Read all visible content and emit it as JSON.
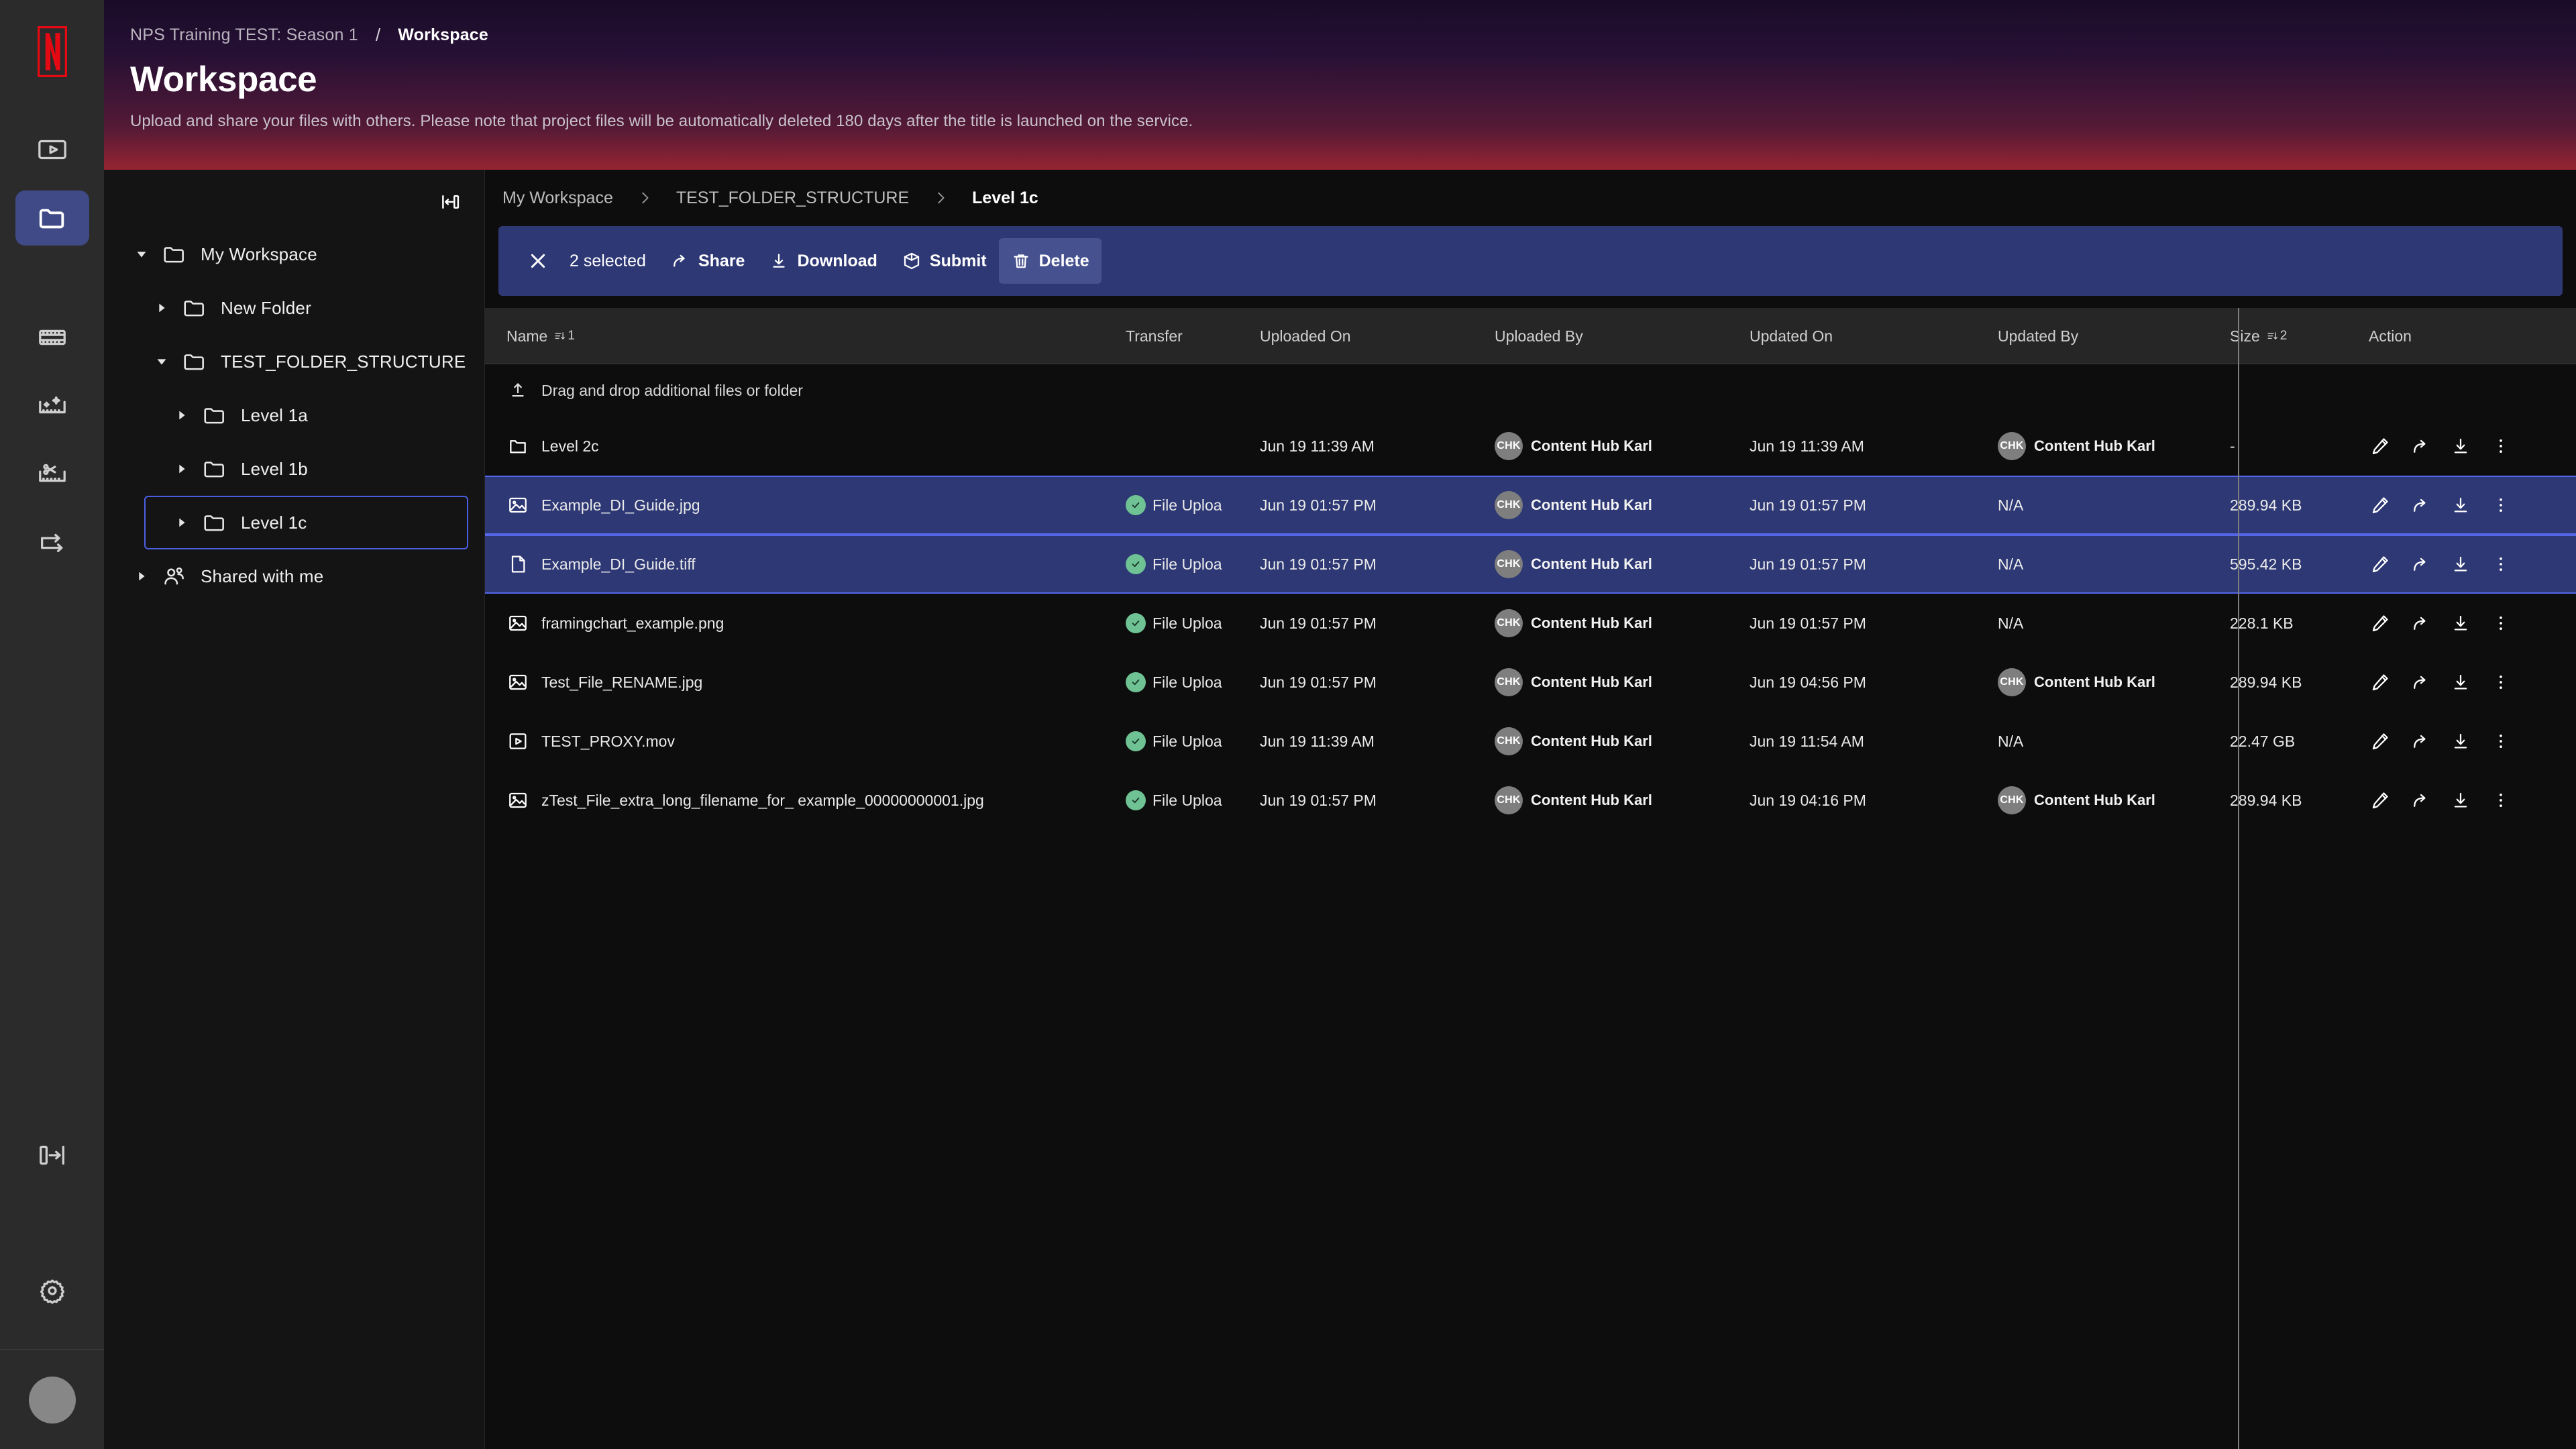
{
  "rail": {
    "logo": "netflix-n-logo",
    "items": [
      {
        "name": "media-player-icon",
        "active": false
      },
      {
        "name": "folder-icon",
        "active": true
      },
      {
        "name": "film-strip-icon",
        "active": false
      },
      {
        "name": "film-sparkle-icon",
        "active": false
      },
      {
        "name": "film-scissors-icon",
        "active": false
      },
      {
        "name": "transfer-arrow-icon",
        "active": false
      }
    ],
    "bottom": [
      {
        "name": "expand-panel-icon"
      },
      {
        "name": "settings-gear-icon"
      }
    ]
  },
  "header": {
    "project": "NPS Training TEST: Season 1",
    "separator": "/",
    "section": "Workspace",
    "title": "Workspace",
    "subtitle": "Upload and share your files with others. Please note that project files will be automatically deleted 180 days after the title is launched on the service."
  },
  "tree": {
    "collapse_icon": "collapse-panel-icon",
    "items": [
      {
        "label": "My Workspace",
        "indent": 0,
        "expanded": true,
        "icon": "folder-icon",
        "selected": false
      },
      {
        "label": "New Folder",
        "indent": 1,
        "expanded": false,
        "icon": "folder-icon",
        "selected": false
      },
      {
        "label": "TEST_FOLDER_STRUCTURE",
        "indent": 1,
        "expanded": true,
        "icon": "folder-icon",
        "selected": false
      },
      {
        "label": "Level 1a",
        "indent": 2,
        "expanded": false,
        "icon": "folder-icon",
        "selected": false
      },
      {
        "label": "Level 1b",
        "indent": 2,
        "expanded": false,
        "icon": "folder-icon",
        "selected": false
      },
      {
        "label": "Level 1c",
        "indent": 2,
        "expanded": false,
        "icon": "folder-icon",
        "selected": true
      },
      {
        "label": "Shared with me",
        "indent": 0,
        "expanded": false,
        "icon": "shared-users-icon",
        "selected": false
      }
    ]
  },
  "breadcrumbs": [
    {
      "label": "My Workspace",
      "current": false
    },
    {
      "label": "TEST_FOLDER_STRUCTURE",
      "current": false
    },
    {
      "label": "Level 1c",
      "current": true
    }
  ],
  "actionbar": {
    "close_icon": "close-icon",
    "count_label": "2 selected",
    "buttons": [
      {
        "label": "Share",
        "icon": "share-arrow-icon",
        "active": false
      },
      {
        "label": "Download",
        "icon": "download-icon",
        "active": false
      },
      {
        "label": "Submit",
        "icon": "box-submit-icon",
        "active": false
      },
      {
        "label": "Delete",
        "icon": "trash-icon",
        "active": true
      }
    ]
  },
  "table": {
    "columns": [
      {
        "key": "name",
        "label": "Name",
        "sort": {
          "dir": "desc",
          "order": "1"
        }
      },
      {
        "key": "transfer",
        "label": "Transfer"
      },
      {
        "key": "uploaded_on",
        "label": "Uploaded On"
      },
      {
        "key": "uploaded_by",
        "label": "Uploaded By"
      },
      {
        "key": "updated_on",
        "label": "Updated On"
      },
      {
        "key": "updated_by",
        "label": "Updated By"
      },
      {
        "key": "size",
        "label": "Size",
        "sort": {
          "dir": "desc",
          "order": "2"
        }
      },
      {
        "key": "action",
        "label": "Action"
      }
    ],
    "dropzone": {
      "label": "Drag and drop additional files or folder",
      "icon": "upload-icon"
    },
    "action_icons": [
      "edit-pencil-icon",
      "share-arrow-icon",
      "download-icon",
      "more-vertical-icon"
    ],
    "rows": [
      {
        "name": "Level 2c",
        "icon": "folder-icon",
        "selected": false,
        "transfer": "",
        "transfer_ok": false,
        "uploaded_on": "Jun 19 11:39 AM",
        "uploaded_by": {
          "initials": "CHK",
          "name": "Content Hub Karl"
        },
        "updated_on": "Jun 19 11:39 AM",
        "updated_by": {
          "initials": "CHK",
          "name": "Content Hub Karl"
        },
        "size": "-"
      },
      {
        "name": "Example_DI_Guide.jpg",
        "icon": "image-icon",
        "selected": true,
        "transfer": "File Uploa",
        "transfer_ok": true,
        "uploaded_on": "Jun 19 01:57 PM",
        "uploaded_by": {
          "initials": "CHK",
          "name": "Content Hub Karl"
        },
        "updated_on": "Jun 19 01:57 PM",
        "updated_by": {
          "initials": "",
          "name": "N/A"
        },
        "size": "289.94 KB"
      },
      {
        "name": "Example_DI_Guide.tiff",
        "icon": "document-icon",
        "selected": true,
        "transfer": "File Uploa",
        "transfer_ok": true,
        "uploaded_on": "Jun 19 01:57 PM",
        "uploaded_by": {
          "initials": "CHK",
          "name": "Content Hub Karl"
        },
        "updated_on": "Jun 19 01:57 PM",
        "updated_by": {
          "initials": "",
          "name": "N/A"
        },
        "size": "595.42 KB"
      },
      {
        "name": "framingchart_example.png",
        "icon": "image-icon",
        "selected": false,
        "transfer": "File Uploa",
        "transfer_ok": true,
        "uploaded_on": "Jun 19 01:57 PM",
        "uploaded_by": {
          "initials": "CHK",
          "name": "Content Hub Karl"
        },
        "updated_on": "Jun 19 01:57 PM",
        "updated_by": {
          "initials": "",
          "name": "N/A"
        },
        "size": "228.1 KB"
      },
      {
        "name": "Test_File_RENAME.jpg",
        "icon": "image-icon",
        "selected": false,
        "transfer": "File Uploa",
        "transfer_ok": true,
        "uploaded_on": "Jun 19 01:57 PM",
        "uploaded_by": {
          "initials": "CHK",
          "name": "Content Hub Karl"
        },
        "updated_on": "Jun 19 04:56 PM",
        "updated_by": {
          "initials": "CHK",
          "name": "Content Hub Karl"
        },
        "size": "289.94 KB"
      },
      {
        "name": "TEST_PROXY.mov",
        "icon": "video-icon",
        "selected": false,
        "transfer": "File Uploa",
        "transfer_ok": true,
        "uploaded_on": "Jun 19 11:39 AM",
        "uploaded_by": {
          "initials": "CHK",
          "name": "Content Hub Karl"
        },
        "updated_on": "Jun 19 11:54 AM",
        "updated_by": {
          "initials": "",
          "name": "N/A"
        },
        "size": "22.47 GB"
      },
      {
        "name": "zTest_File_extra_long_filename_for_ example_00000000001.jpg",
        "icon": "image-icon",
        "selected": false,
        "transfer": "File Uploa",
        "transfer_ok": true,
        "uploaded_on": "Jun 19 01:57 PM",
        "uploaded_by": {
          "initials": "CHK",
          "name": "Content Hub Karl"
        },
        "updated_on": "Jun 19 04:16 PM",
        "updated_by": {
          "initials": "CHK",
          "name": "Content Hub Karl"
        },
        "size": "289.94 KB"
      }
    ]
  },
  "colors": {
    "accent_blue": "#5567e8",
    "selection_bg": "#2e3874",
    "rail_active": "#3f4a86",
    "status_green": "#6ec294",
    "brand_red": "#e50914"
  }
}
